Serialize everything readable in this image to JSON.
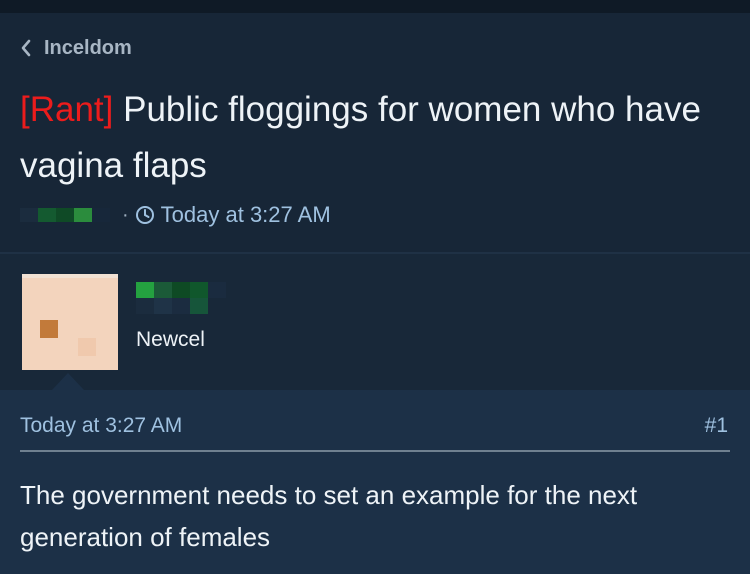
{
  "breadcrumb": {
    "label": "Inceldom"
  },
  "thread": {
    "prefix": "[Rant]",
    "title": " Public floggings for women who have vagina flaps",
    "time": "Today at 3:27 AM"
  },
  "author": {
    "rank": "Newcel"
  },
  "post": {
    "date": "Today at 3:27 AM",
    "number": "#1",
    "body": "The government needs to set an example for the next generation of females"
  },
  "colors": {
    "background": "#152231",
    "prefix_red": "#ec1c1c",
    "link_blue": "#9fc1e0",
    "post_bg": "#1c3047"
  },
  "icons": {
    "back": "chevron-left-icon",
    "clock": "clock-icon"
  }
}
